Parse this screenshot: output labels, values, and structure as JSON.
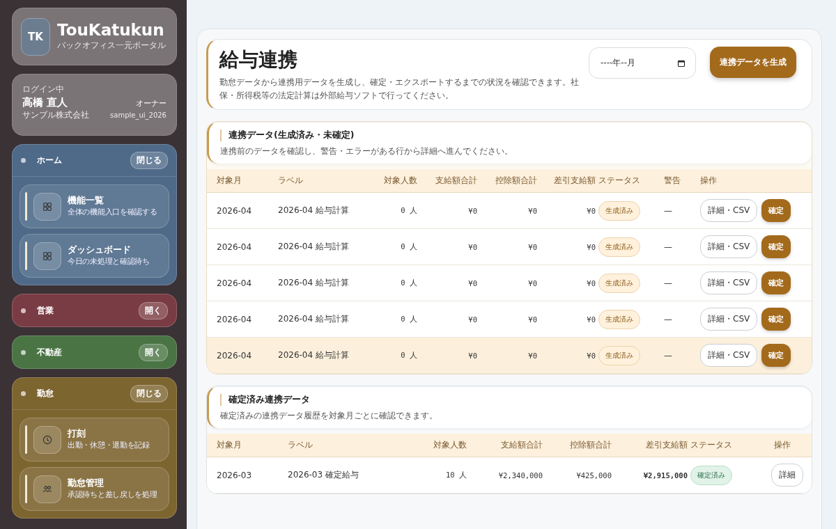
{
  "brand": {
    "initials": "TK",
    "name": "TouKatukun",
    "tagline": "バックオフィス一元ポータル"
  },
  "user": {
    "caption": "ログイン中",
    "name": "高橋 直人",
    "role": "オーナー",
    "company": "サンプル株式会社",
    "account": "sample_ui_2026"
  },
  "sidebar": {
    "groups": [
      {
        "title": "ホーム",
        "color": "#4f6a88",
        "toggle": "閉じる",
        "expanded": true,
        "items": [
          {
            "title": "機能一覧",
            "subtitle": "全体の機能入口を確認する",
            "kind": "grid"
          },
          {
            "title": "ダッシュボード",
            "subtitle": "今日の未処理と確認待ち",
            "kind": "grid"
          }
        ]
      },
      {
        "title": "営業",
        "color": "#7a3c44",
        "toggle": "開く",
        "expanded": false
      },
      {
        "title": "不動産",
        "color": "#4a7444",
        "toggle": "開く",
        "expanded": false
      },
      {
        "title": "勤怠",
        "color": "#7d6530",
        "toggle": "閉じる",
        "expanded": true,
        "items": [
          {
            "title": "打刻",
            "subtitle": "出勤・休憩・退勤を記録",
            "kind": "clock"
          },
          {
            "title": "勤怠管理",
            "subtitle": "承認待ちと差し戻しを処理",
            "kind": "people"
          }
        ]
      }
    ]
  },
  "page": {
    "title": "給与連携",
    "description": "勤怠データから連携用データを生成し、確定・エクスポートするまでの状況を確認できます。社保・所得税等の法定計算は外部給与ソフトで行ってください。",
    "month_field": {
      "value": "----年--月"
    },
    "generate_button": "連携データを生成"
  },
  "sections": [
    {
      "title": "連携データ(生成済み・未確定)",
      "description": "連携前のデータを確認し、警告・エラーがある行から詳細へ進んでください。",
      "columns": [
        "対象月",
        "ラベル",
        "対象人数",
        "支給額合計",
        "控除額合計",
        "差引支給額",
        "ステータス",
        "警告",
        "操作"
      ],
      "rows": [
        {
          "selected": false,
          "cells": [
            "2026-04",
            "2026-04 給与計算",
            "0 人",
            "¥0",
            "¥0",
            "¥0",
            {
              "text": "生成済み",
              "kind": "generated"
            },
            "—",
            {
              "buttons": [
                {
                  "label": "詳細・CSV",
                  "kind": "outline"
                },
                {
                  "label": "確定",
                  "kind": "primary"
                }
              ]
            }
          ]
        },
        {
          "selected": false,
          "cells": [
            "2026-04",
            "2026-04 給与計算",
            "0 人",
            "¥0",
            "¥0",
            "¥0",
            {
              "text": "生成済み",
              "kind": "generated"
            },
            "—",
            {
              "buttons": [
                {
                  "label": "詳細・CSV",
                  "kind": "outline"
                },
                {
                  "label": "確定",
                  "kind": "primary"
                }
              ]
            }
          ]
        },
        {
          "selected": false,
          "cells": [
            "2026-04",
            "2026-04 給与計算",
            "0 人",
            "¥0",
            "¥0",
            "¥0",
            {
              "text": "生成済み",
              "kind": "generated"
            },
            "—",
            {
              "buttons": [
                {
                  "label": "詳細・CSV",
                  "kind": "outline"
                },
                {
                  "label": "確定",
                  "kind": "primary"
                }
              ]
            }
          ]
        },
        {
          "selected": false,
          "cells": [
            "2026-04",
            "2026-04 給与計算",
            "0 人",
            "¥0",
            "¥0",
            "¥0",
            {
              "text": "生成済み",
              "kind": "generated"
            },
            "—",
            {
              "buttons": [
                {
                  "label": "詳細・CSV",
                  "kind": "outline"
                },
                {
                  "label": "確定",
                  "kind": "primary"
                }
              ]
            }
          ]
        },
        {
          "selected": true,
          "cells": [
            "2026-04",
            "2026-04 給与計算",
            "0 人",
            "¥0",
            "¥0",
            "¥0",
            {
              "text": "生成済み",
              "kind": "generated"
            },
            "—",
            {
              "buttons": [
                {
                  "label": "詳細・CSV",
                  "kind": "outline"
                },
                {
                  "label": "確定",
                  "kind": "primary"
                }
              ]
            }
          ]
        }
      ]
    },
    {
      "title": "確定済み連携データ",
      "description": "確定済みの連携データ履歴を対象月ごとに確認できます。",
      "columns": [
        "対象月",
        "ラベル",
        "対象人数",
        "支給額合計",
        "控除額合計",
        "差引支給額",
        "ステータス",
        "操作"
      ],
      "rows": [
        {
          "selected": false,
          "cells": [
            "2026-03",
            "2026-03 確定給与",
            "10 人",
            "¥2,340,000",
            "¥425,000",
            "¥2,915,000",
            {
              "text": "確定済み",
              "kind": "confirmed"
            },
            {
              "buttons": [
                {
                  "label": "詳細",
                  "kind": "outline"
                }
              ]
            }
          ]
        }
      ]
    }
  ]
}
